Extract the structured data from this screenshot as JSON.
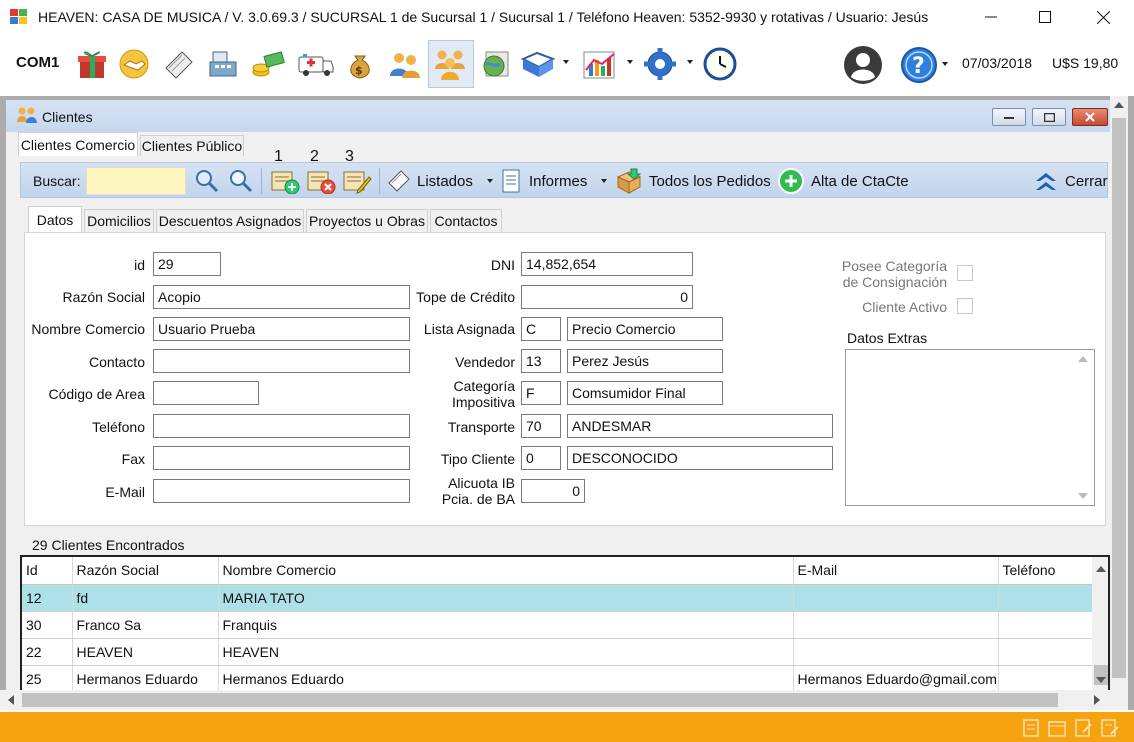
{
  "window": {
    "title": "HEAVEN: CASA DE MUSICA / V. 3.0.69.3 / SUCURSAL 1 de Sucursal 1 / Sucursal 1 / Teléfono Heaven: 5352-9930 y rotativas / Usuario: Jesús"
  },
  "toolbar": {
    "port": "COM1",
    "date": "07/03/2018",
    "rate": "U$S 19,80",
    "icons": [
      "gift-icon",
      "handshake-icon",
      "notebook-icon",
      "cash-register-icon",
      "money-icon",
      "ambulance-icon",
      "money-bag-icon",
      "users-icon",
      "group-icon",
      "globe-icon",
      "book-icon",
      "chart-icon",
      "settings-icon",
      "clock-icon",
      "user-icon",
      "help-icon"
    ]
  },
  "clientes": {
    "title": "Clientes",
    "tabs": [
      "Clientes Comercio",
      "Clientes Público"
    ],
    "search_label": "Buscar:",
    "search_value": "",
    "numbers": [
      "1",
      "2",
      "3"
    ],
    "listados": "Listados",
    "informes": "Informes",
    "todos_pedidos": "Todos los Pedidos",
    "alta_ctacte": "Alta de CtaCte",
    "cerrar": "Cerrar",
    "subtabs": [
      "Datos",
      "Domicilios",
      "Descuentos Asignados",
      "Proyectos u Obras",
      "Contactos"
    ]
  },
  "form": {
    "id_label": "id",
    "id": "29",
    "razon_label": "Razón Social",
    "razon": "Acopio",
    "nombre_label": "Nombre Comercio",
    "nombre": "Usuario Prueba",
    "contacto_label": "Contacto",
    "contacto": "",
    "codarea_label": "Código de Area",
    "codarea": "",
    "telefono_label": "Teléfono",
    "telefono": "",
    "fax_label": "Fax",
    "fax": "",
    "email_label": "E-Mail",
    "email": "",
    "dni_label": "DNI",
    "dni": "14,852,654",
    "tope_label": "Tope de Crédito",
    "tope": "0",
    "lista_label": "Lista Asignada",
    "lista_code": "C",
    "lista_name": "Precio Comercio",
    "vendedor_label": "Vendedor",
    "vendedor_code": "13",
    "vendedor_name": "Perez Jesús",
    "categoria_label1": "Categoría",
    "categoria_label2": "Impositiva",
    "categoria_code": "F",
    "categoria_name": "Comsumidor Final",
    "transporte_label": "Transporte",
    "transporte_code": "70",
    "transporte_name": "ANDESMAR",
    "tipo_label": "Tipo Cliente",
    "tipo_code": "0",
    "tipo_name": "DESCONOCIDO",
    "alicuota_label1": "Alicuota IB",
    "alicuota_label2": "Pcia. de BA",
    "alicuota": "0",
    "consignacion_label1": "Posee Categoría",
    "consignacion_label2": "de Consignación",
    "activo_label": "Cliente Activo",
    "extras_label": "Datos Extras"
  },
  "grid": {
    "count_text": "29 Clientes Encontrados",
    "columns": [
      "Id",
      "Razón Social",
      "Nombre Comercio",
      "E-Mail",
      "Teléfono"
    ],
    "rows": [
      [
        "12",
        "fd",
        "MARIA TATO",
        "",
        ""
      ],
      [
        "30",
        "Franco Sa",
        "Franquis",
        "",
        ""
      ],
      [
        "22",
        "HEAVEN",
        "HEAVEN",
        "",
        ""
      ],
      [
        "25",
        "Hermanos Eduardo",
        "Hermanos Eduardo",
        "Hermanos Eduardo@gmail.com",
        ""
      ]
    ]
  },
  "colors": {
    "accent_orange": "#f7a20f",
    "toolbar_blue": "#c6d7ee",
    "selected_row": "#aee0e8",
    "search_yellow": "#fff7c0"
  }
}
